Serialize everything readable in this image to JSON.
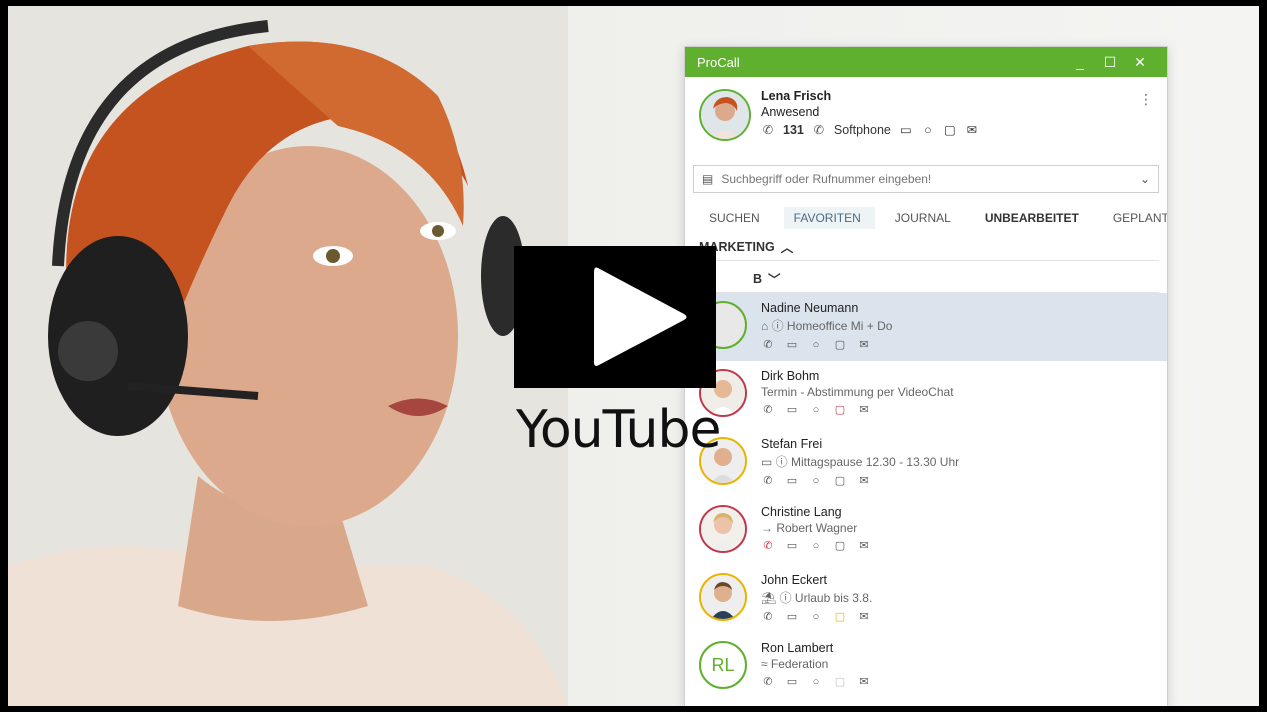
{
  "window": {
    "title": "ProCall",
    "controls": [
      "_",
      "☐",
      "✕"
    ]
  },
  "me": {
    "name": "Lena Frisch",
    "status": "Anwesend",
    "extension": "131",
    "device": "Softphone"
  },
  "search": {
    "placeholder": "Suchbegriff oder Rufnummer eingeben!"
  },
  "tabs": [
    "SUCHEN",
    "FAVORITEN",
    "JOURNAL",
    "UNBEARBEITET",
    "GEPLANT"
  ],
  "groups": {
    "marketing": "MARKETING",
    "second": "B"
  },
  "contacts": [
    {
      "name": "Nadine Neumann",
      "sub": "Homeoffice Mi + Do"
    },
    {
      "name": "Dirk Bohm",
      "sub": "Termin - Abstimmung per VideoChat"
    },
    {
      "name": "Stefan Frei",
      "sub": "Mittagspause 12.30 - 13.30 Uhr"
    },
    {
      "name": "Christine Lang",
      "sub": "Robert Wagner"
    },
    {
      "name": "John Eckert",
      "sub": "Urlaub bis 3.8."
    },
    {
      "name": "Ron Lambert",
      "sub": "Federation",
      "initials": "RL"
    }
  ],
  "youtube": {
    "label": "YouTube"
  },
  "colors": {
    "accent": "#5fb02f",
    "selected_row": "#dbe4ec"
  }
}
